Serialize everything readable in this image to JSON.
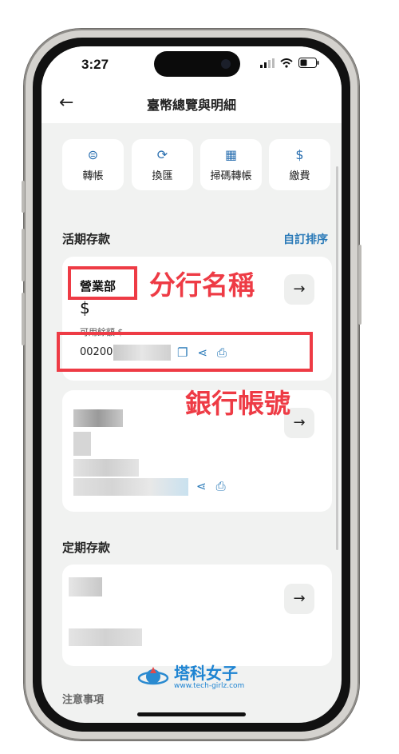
{
  "status": {
    "time": "3:27"
  },
  "header": {
    "title": "臺幣總覽與明細"
  },
  "quick_actions": [
    {
      "label": "轉帳",
      "icon": "transfer-icon"
    },
    {
      "label": "換匯",
      "icon": "exchange-icon"
    },
    {
      "label": "掃碼轉帳",
      "icon": "qr-icon"
    },
    {
      "label": "繳費",
      "icon": "pay-icon"
    }
  ],
  "demand": {
    "section_label": "活期存款",
    "custom_sort": "自訂排序",
    "account1": {
      "branch": "營業部",
      "currency": "$",
      "available": "可用餘額 $",
      "number_prefix": "00200"
    }
  },
  "fixed": {
    "section_label": "定期存款"
  },
  "notice": {
    "label": "注意事項"
  },
  "annotations": {
    "branch_name": "分行名稱",
    "account_number": "銀行帳號"
  },
  "watermark": {
    "title": "塔科女子",
    "url": "www.tech-girlz.com"
  },
  "colors": {
    "accent": "#2a7ab8",
    "annotation_red": "#ee3b45",
    "background": "#f1f2f1"
  }
}
